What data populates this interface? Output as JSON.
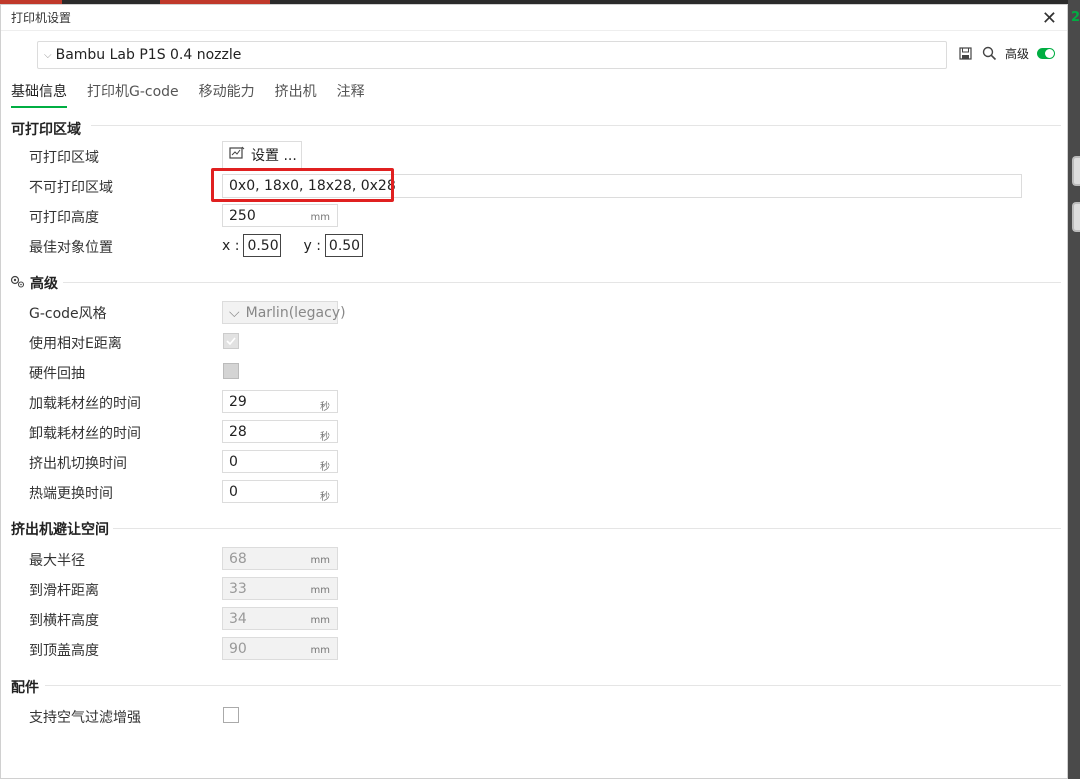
{
  "dialog": {
    "title": "打印机设置",
    "close_glyph": "✕"
  },
  "preset": {
    "name": "Bambu Lab P1S 0.4 nozzle"
  },
  "toolbar": {
    "advanced_label": "高级"
  },
  "tabs": [
    {
      "label": "基础信息",
      "active": true
    },
    {
      "label": "打印机G-code",
      "active": false
    },
    {
      "label": "移动能力",
      "active": false
    },
    {
      "label": "挤出机",
      "active": false
    },
    {
      "label": "注释",
      "active": false
    }
  ],
  "printable_area": {
    "title": "可打印区域",
    "area_label": "可打印区域",
    "setup_button": "设置 ...",
    "excluded_label": "不可打印区域",
    "excluded_value": "0x0, 18x0, 18x28, 0x28",
    "height_label": "可打印高度",
    "height_value": "250",
    "height_unit": "mm",
    "best_pos_label": "最佳对象位置",
    "x_label": "x :",
    "x_value": "0.50",
    "y_label": "y :",
    "y_value": "0.50"
  },
  "advanced": {
    "title": "高级",
    "gcode_flavor_label": "G-code风格",
    "gcode_flavor_value": "Marlin(legacy)",
    "relative_e_label": "使用相对E距离",
    "relative_e_checked": true,
    "fw_retract_label": "硬件回抽",
    "fw_retract_checked": false,
    "load_time_label": "加载耗材丝的时间",
    "load_time_value": "29",
    "unload_time_label": "卸载耗材丝的时间",
    "unload_time_value": "28",
    "tool_change_label": "挤出机切换时间",
    "tool_change_value": "0",
    "hotend_change_label": "热端更换时间",
    "hotend_change_value": "0",
    "sec_unit": "秒"
  },
  "clearance": {
    "title": "挤出机避让空间",
    "radius_label": "最大半径",
    "radius_value": "68",
    "rod_dist_label": "到滑杆距离",
    "rod_dist_value": "33",
    "rod_height_label": "到横杆高度",
    "rod_height_value": "34",
    "lid_height_label": "到顶盖高度",
    "lid_height_value": "90",
    "unit": "mm"
  },
  "accessory": {
    "title": "配件",
    "air_filter_label": "支持空气过滤增强",
    "air_filter_checked": false
  },
  "colors": {
    "accent": "#00ae42",
    "highlight": "#e02020"
  }
}
